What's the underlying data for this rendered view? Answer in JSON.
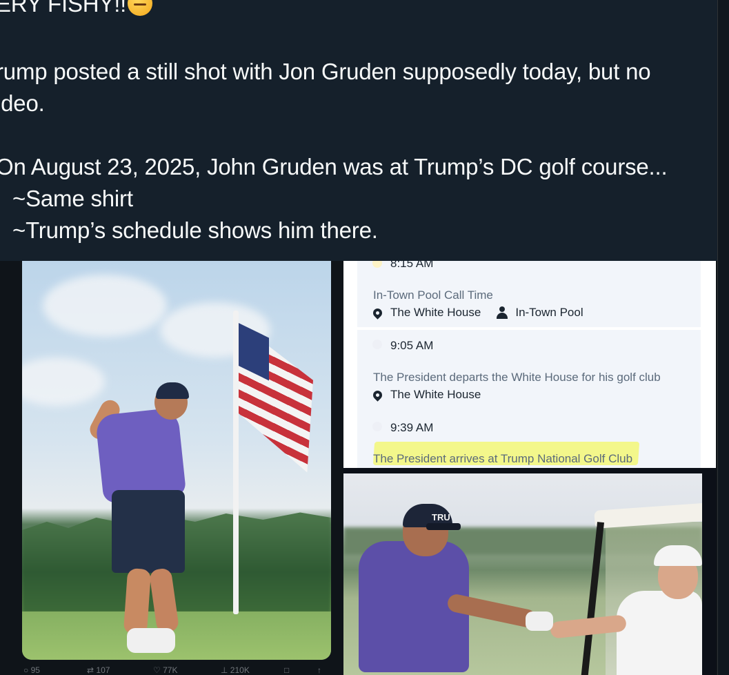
{
  "tweet": {
    "lines": [
      "ERY FISHY!!",
      "rump posted a still shot with Jon Gruden supposedly today, but no",
      "ideo.",
      "On August 23, 2025, John Gruden was at Trump’s DC golf course...",
      "~Same shirt",
      "~Trump’s schedule shows him there."
    ]
  },
  "schedule": {
    "entries": [
      {
        "time": "8:15 AM",
        "title": "In-Town Pool Call Time",
        "location": "The White House",
        "pool": "In-Town Pool"
      },
      {
        "time": "9:05 AM",
        "title": "The President departs the White House for his golf club",
        "location": "The White House"
      },
      {
        "time": "9:39 AM",
        "title": "The President arrives at Trump National Golf Club"
      }
    ]
  },
  "photo2": {
    "cap_text": "TRU"
  },
  "actions": {
    "reply": "95",
    "retweet": "107",
    "like": "77K",
    "views": "210K"
  },
  "colors": {
    "background": "#15202b",
    "text": "#f7f9f9",
    "highlight": "#f3f77e"
  }
}
